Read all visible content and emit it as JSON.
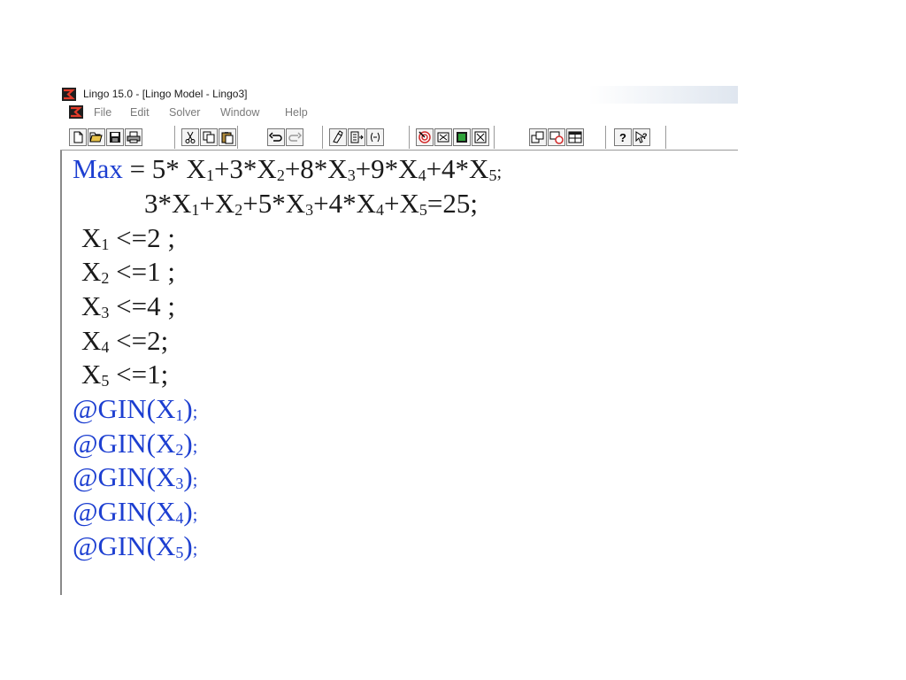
{
  "window": {
    "title": "Lingo 15.0 - [Lingo Model - Lingo3]",
    "app_icon": "lingo-logo-icon",
    "doc_icon": "lingo-document-icon"
  },
  "menu": {
    "items": [
      "File",
      "Edit",
      "Solver",
      "Window",
      "Help"
    ]
  },
  "toolbar": {
    "buttons": [
      "new-icon",
      "open-icon",
      "save-icon",
      "print-icon",
      "cut-icon",
      "copy-icon",
      "paste-icon",
      "undo-icon",
      "redo-icon",
      "find-icon",
      "goto-line-icon",
      "match-parenthesis-icon",
      "solve-icon",
      "solution-icon",
      "matrix-picture-icon",
      "close-all-icon",
      "send-to-back-icon",
      "close-all-windows-icon",
      "tile-icon",
      "help-icon",
      "context-help-icon"
    ]
  },
  "editor": {
    "colors": {
      "keyword": "#1d3fd1",
      "text": "#1a1a1a"
    },
    "lines": [
      {
        "keyword": "Max",
        "rest_a": " = 5* X",
        "s1": "1",
        "rest_b": "+3*X",
        "s2": "2",
        "rest_c": "+8*X",
        "s3": "3",
        "rest_d": "+9*X",
        "s4": "4",
        "rest_e": "+4*X",
        "s5": "5",
        "end": ";"
      },
      {
        "a": "3*X",
        "s1": "1",
        "b": "+X",
        "s2": "2",
        "c": "+5*X",
        "s3": "3",
        "d": "+4*X",
        "s4": "4",
        "e": "+X",
        "s5": "5",
        "f": "=25;"
      },
      {
        "var": "X",
        "sub": "1",
        "rest": " <=2 ;"
      },
      {
        "var": "X",
        "sub": "2",
        "rest": " <=1 ;"
      },
      {
        "var": "X",
        "sub": "3",
        "rest": " <=4 ;"
      },
      {
        "var": "X",
        "sub": "4",
        "rest": " <=2;"
      },
      {
        "var": "X",
        "sub": "5",
        "rest": " <=1;"
      },
      {
        "fn": "@GIN(X",
        "sub": "1",
        "close": ")",
        "end": ";"
      },
      {
        "fn": "@GIN(X",
        "sub": "2",
        "close": ")",
        "end": ";"
      },
      {
        "fn": "@GIN(X",
        "sub": "3",
        "close": ")",
        "end": ";"
      },
      {
        "fn": "@GIN(X",
        "sub": "4",
        "close": ")",
        "end": ";"
      },
      {
        "fn": "@GIN(X",
        "sub": "5",
        "close": ")",
        "end": ";"
      }
    ]
  }
}
